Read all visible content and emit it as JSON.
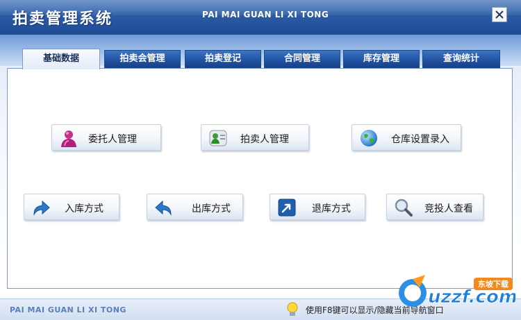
{
  "window": {
    "title": "拍卖管理系统",
    "subtitle": "PAI MAI GUAN LI XI TONG"
  },
  "tabs": [
    {
      "label": "基础数据",
      "active": true
    },
    {
      "label": "拍卖会管理",
      "active": false
    },
    {
      "label": "拍卖登记",
      "active": false
    },
    {
      "label": "合同管理",
      "active": false
    },
    {
      "label": "库存管理",
      "active": false
    },
    {
      "label": "查询统计",
      "active": false
    }
  ],
  "buttons": [
    {
      "label": "委托人管理",
      "icon": "user-icon"
    },
    {
      "label": "拍卖人管理",
      "icon": "users-card-icon"
    },
    {
      "label": "仓库设置录入",
      "icon": "globe-icon"
    },
    {
      "label": "入库方式",
      "icon": "arrow-forward-icon"
    },
    {
      "label": "出库方式",
      "icon": "arrow-back-icon"
    },
    {
      "label": "退库方式",
      "icon": "arrow-diagonal-icon"
    },
    {
      "label": "竞投人查看",
      "icon": "magnifier-icon"
    }
  ],
  "status": {
    "brand": "PAI MAI GUAN LI XI TONG",
    "hint": "使用F8键可以显示/隐藏当前导航窗口"
  },
  "watermark": {
    "text": "uzzf.com",
    "tag": "东坡下载"
  },
  "colors": {
    "titlebar": "#2b5aa5",
    "tab": "#2356a6",
    "panel_border": "#7c98c4"
  }
}
